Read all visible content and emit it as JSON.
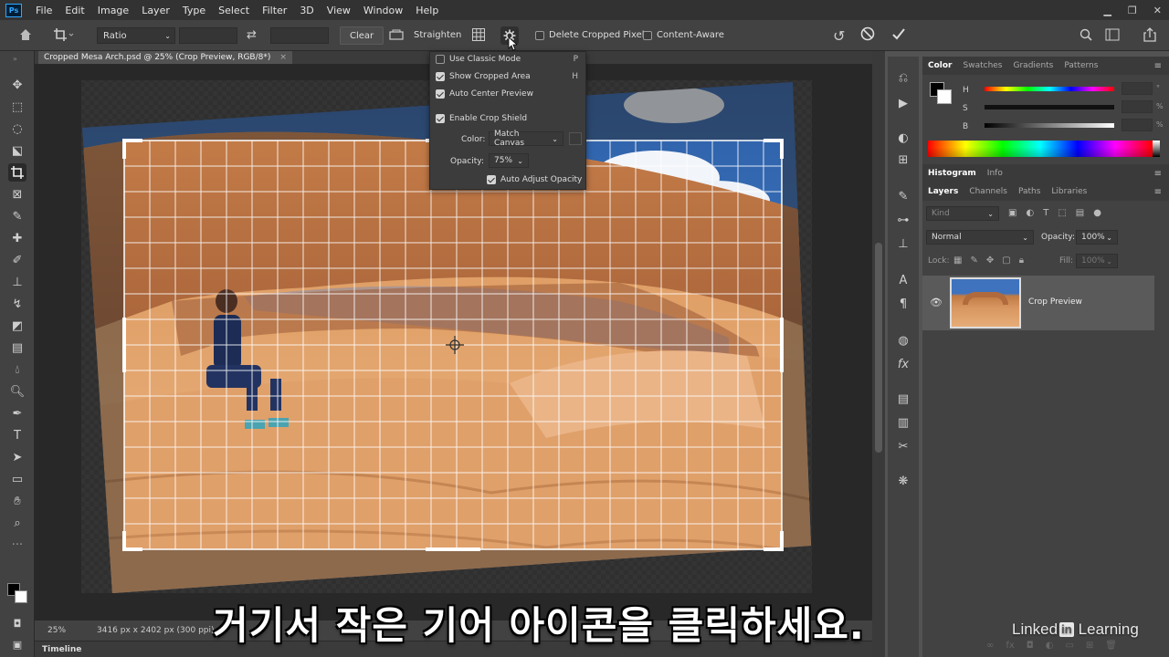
{
  "app": {
    "logo_text": "Ps"
  },
  "menubar": {
    "items": [
      "File",
      "Edit",
      "Image",
      "Layer",
      "Type",
      "Select",
      "Filter",
      "3D",
      "View",
      "Window",
      "Help"
    ]
  },
  "options_bar": {
    "ratio_label": "Ratio",
    "clear_label": "Clear",
    "straighten_label": "Straighten",
    "delete_cropped_pixels_label": "Delete Cropped Pixels",
    "content_aware_label": "Content-Aware",
    "delete_cropped_pixels_checked": false,
    "content_aware_checked": false
  },
  "document": {
    "tab_title": "Cropped Mesa Arch.psd @ 25% (Crop Preview, RGB/8*)",
    "close_glyph": "×"
  },
  "crop_options_popup": {
    "use_classic_mode": {
      "label": "Use Classic Mode",
      "shortcut": "P",
      "checked": false
    },
    "show_cropped_area": {
      "label": "Show Cropped Area",
      "shortcut": "H",
      "checked": true
    },
    "auto_center_preview": {
      "label": "Auto Center Preview",
      "checked": true
    },
    "enable_crop_shield": {
      "label": "Enable Crop Shield",
      "checked": true
    },
    "color_label": "Color:",
    "color_value": "Match Canvas",
    "opacity_label": "Opacity:",
    "opacity_value": "75%",
    "auto_adjust_opacity": {
      "label": "Auto Adjust Opacity",
      "checked": true
    }
  },
  "status_bar": {
    "zoom": "25%",
    "dimensions": "3416 px x 2402 px (300 ppi)"
  },
  "timeline_label": "Timeline",
  "color_panel": {
    "tabs": [
      "Color",
      "Swatches",
      "Gradients",
      "Patterns"
    ],
    "active_tab": "Color",
    "channels": [
      {
        "label": "H",
        "unit": "°"
      },
      {
        "label": "S",
        "unit": "%"
      },
      {
        "label": "B",
        "unit": "%"
      }
    ]
  },
  "histogram_panel": {
    "tabs": [
      "Histogram",
      "Info"
    ],
    "active_tab": "Histogram"
  },
  "layers_panel": {
    "tabs": [
      "Layers",
      "Channels",
      "Paths",
      "Libraries"
    ],
    "active_tab": "Layers",
    "filter_placeholder": "Kind",
    "blend_mode": "Normal",
    "opacity_label": "Opacity:",
    "opacity_value": "100%",
    "lock_label": "Lock:",
    "fill_label": "Fill:",
    "fill_value": "100%",
    "layers": [
      {
        "name": "Crop Preview",
        "visible": true
      }
    ]
  },
  "subtitle": "거기서 작은 기어 아이콘을 클릭하세요.",
  "watermark": {
    "left": "Linked",
    "in": "in",
    "right": "Learning"
  },
  "colors": {
    "accent": "#31a8ff",
    "panel_bg": "#424242",
    "canvas_bg": "#282828",
    "app_bg": "#535353"
  }
}
